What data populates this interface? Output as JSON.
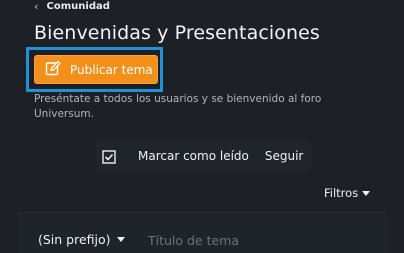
{
  "breadcrumb": {
    "label": "Comunidad"
  },
  "page": {
    "title": "Bienvenidas y Presentaciones"
  },
  "publish_button": {
    "label": "Publicar tema",
    "icon": "edit-icon"
  },
  "description": "Preséntate a todos los usuarios y se bienvenido al foro Universum.",
  "actions": {
    "mark_read_label": "Marcar como leído",
    "mark_read_icon": "checkbox-checked-icon",
    "follow_label": "Seguir"
  },
  "filters": {
    "label": "Filtros"
  },
  "new_thread": {
    "prefix_label": "(Sin prefijo)",
    "title_placeholder": "Título de tema"
  },
  "colors": {
    "background": "#1d2127",
    "accent": "#f39019",
    "highlight": "#1f93d6"
  }
}
